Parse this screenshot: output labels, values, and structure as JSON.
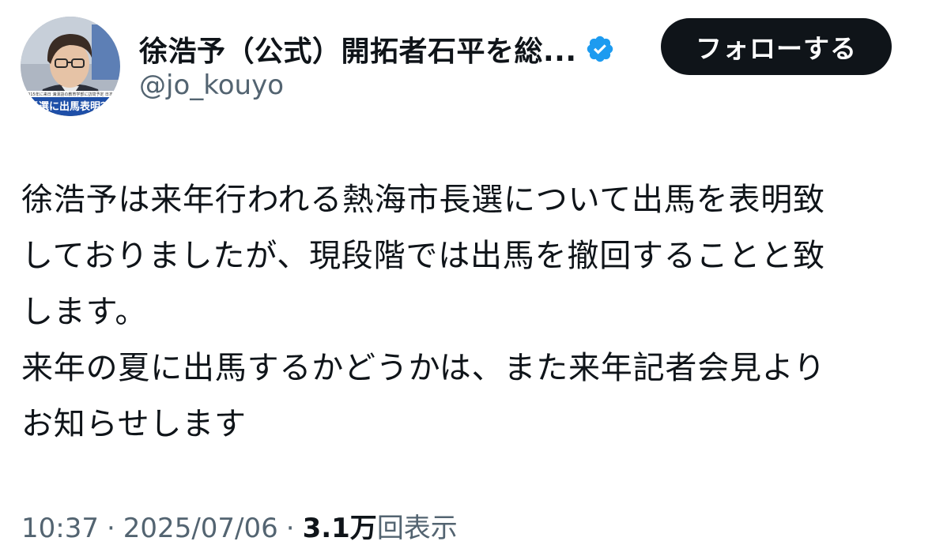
{
  "author": {
    "display_name": "徐浩予（公式）開拓者石平を総...",
    "handle": "@jo_kouyo",
    "verified_icon": "verified-badge-icon",
    "avatar_caption_small": "2015年に来日 満漢語の教育学部に訪問予定 日本の",
    "avatar_caption_banner": "長選に出馬表明？"
  },
  "follow_button": {
    "label": "フォローする"
  },
  "tweet": {
    "lines": [
      "徐浩予は来年行われる熱海市長選について出馬を表明致",
      "しておりましたが、現段階では出馬を撤回することと致",
      "します。",
      "来年の夏に出馬するかどうかは、また来年記者会見より",
      "お知らせします"
    ]
  },
  "meta": {
    "time": "10:37",
    "separator": "·",
    "date": "2025/07/06",
    "views_count": "3.1万",
    "views_label": "回表示"
  },
  "colors": {
    "text_primary": "#0f1419",
    "text_secondary": "#536471",
    "verified_blue": "#1d9bf0",
    "follow_bg": "#0f1419"
  }
}
